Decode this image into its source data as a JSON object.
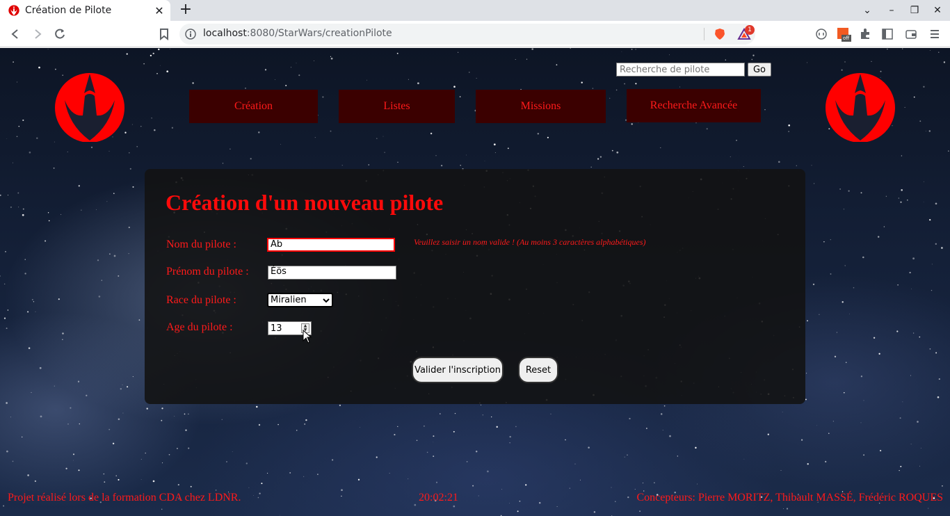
{
  "browser": {
    "tab_title": "Création de Pilote",
    "url_host": "localhost",
    "url_path": ":8080/StarWars/creationPilote",
    "notification_count": "1",
    "extension_badge": "off"
  },
  "search": {
    "placeholder": "Recherche de pilote",
    "button_label": "Go"
  },
  "nav": {
    "creation": "Création",
    "listes": "Listes",
    "missions": "Missions",
    "recherche_avancee": "Recherche Avancée"
  },
  "form": {
    "title": "Création d'un nouveau pilote",
    "nom_label": "Nom du pilote :",
    "nom_value": "Ab",
    "nom_error": "Veuillez saisir un nom valide ! (Au moins 3 caractères alphabétiques)",
    "prenom_label": "Prénom du pilote :",
    "prenom_value": "Éös",
    "race_label": "Race du pilote :",
    "race_value": "Miralien",
    "age_label": "Age du pilote :",
    "age_value": "13",
    "submit_label": "Valider l'inscription",
    "reset_label": "Reset"
  },
  "footer": {
    "left": "Projet réalisé lors de la formation CDA chez LDNR.",
    "clock": "20:02:21",
    "right": "Concepteurs: Pierre MORITZ, Thibault MASSÉ, Frédéric ROQUES"
  },
  "colors": {
    "accent_red": "#ff1a1a",
    "nav_bg": "#3b0000",
    "panel_bg": "#121212"
  },
  "icons": [
    "rebel-alliance-icon",
    "back-icon",
    "forward-icon",
    "reload-icon",
    "bookmark-icon",
    "site-info-icon",
    "brave-shields-icon",
    "brave-rewards-icon",
    "vpn-icon",
    "extension-icon",
    "puzzle-icon",
    "sidebar-icon",
    "wallet-icon",
    "menu-icon"
  ]
}
